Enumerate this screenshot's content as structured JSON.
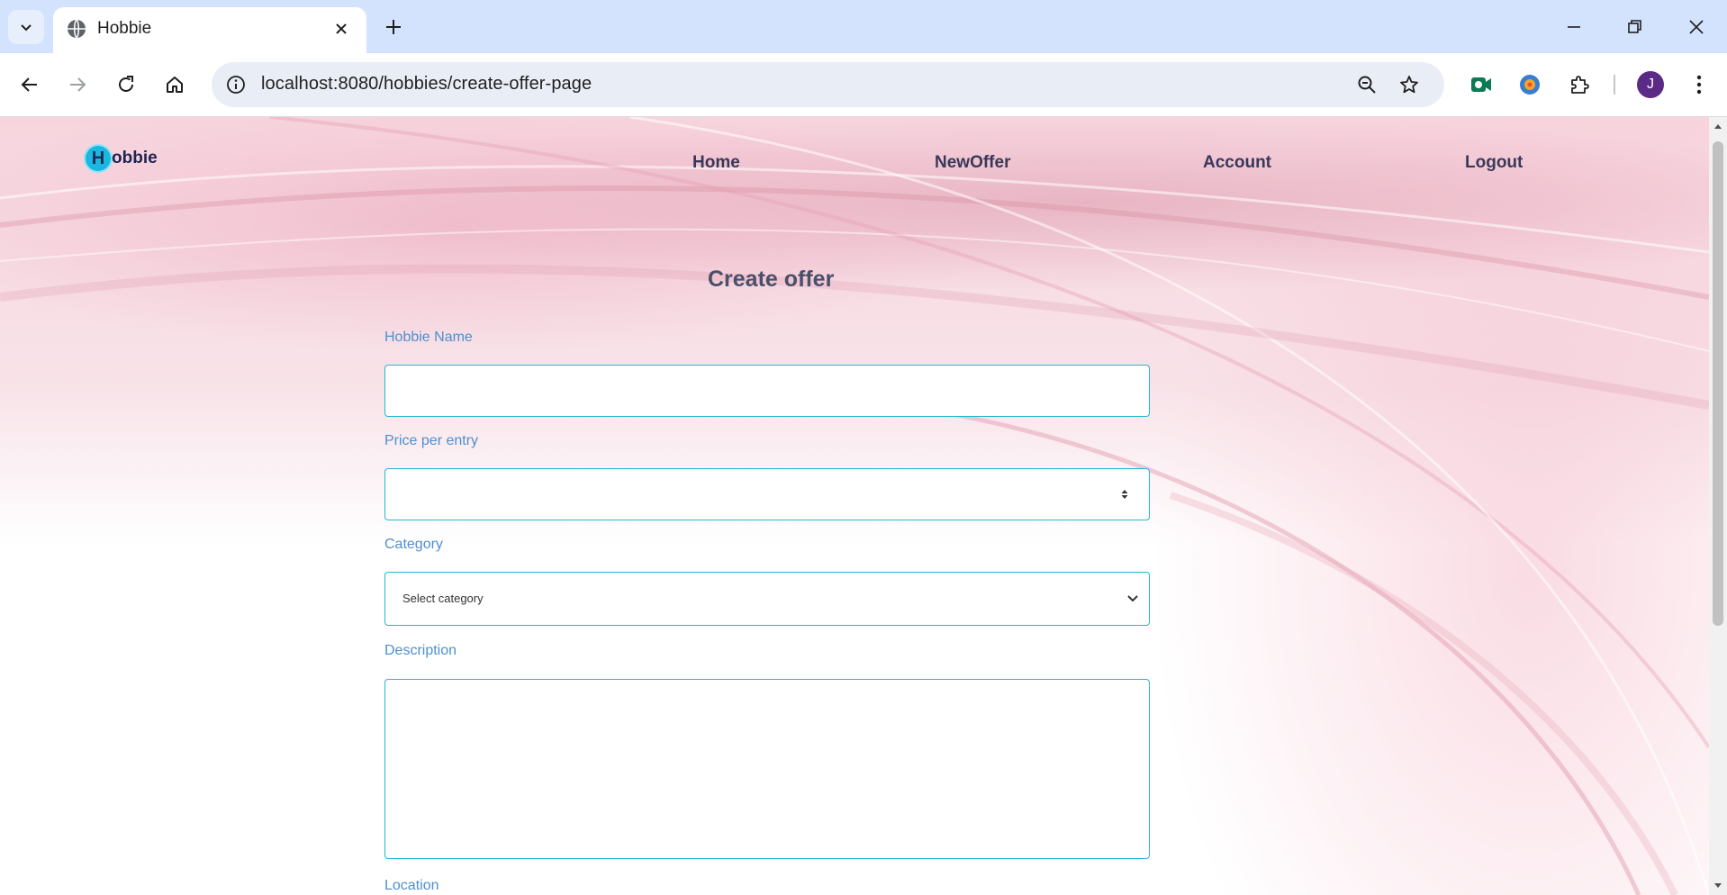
{
  "browser": {
    "tab_title": "Hobbie",
    "url": "localhost:8080/hobbies/create-offer-page",
    "profile_initial": "J"
  },
  "site": {
    "logo_letter": "H",
    "logo_text": "obbie",
    "nav": [
      "Home",
      "NewOffer",
      "Account",
      "Logout"
    ]
  },
  "form": {
    "title": "Create offer",
    "name_label": "Hobbie Name",
    "name_value": "",
    "price_label": "Price per entry",
    "price_value": "",
    "category_label": "Category",
    "category_selected": "Select category",
    "description_label": "Description",
    "description_value": "",
    "location_label": "Location"
  },
  "colors": {
    "accent": "#22b8d0",
    "label": "#4d8fcf",
    "nav_text": "#39385a"
  }
}
